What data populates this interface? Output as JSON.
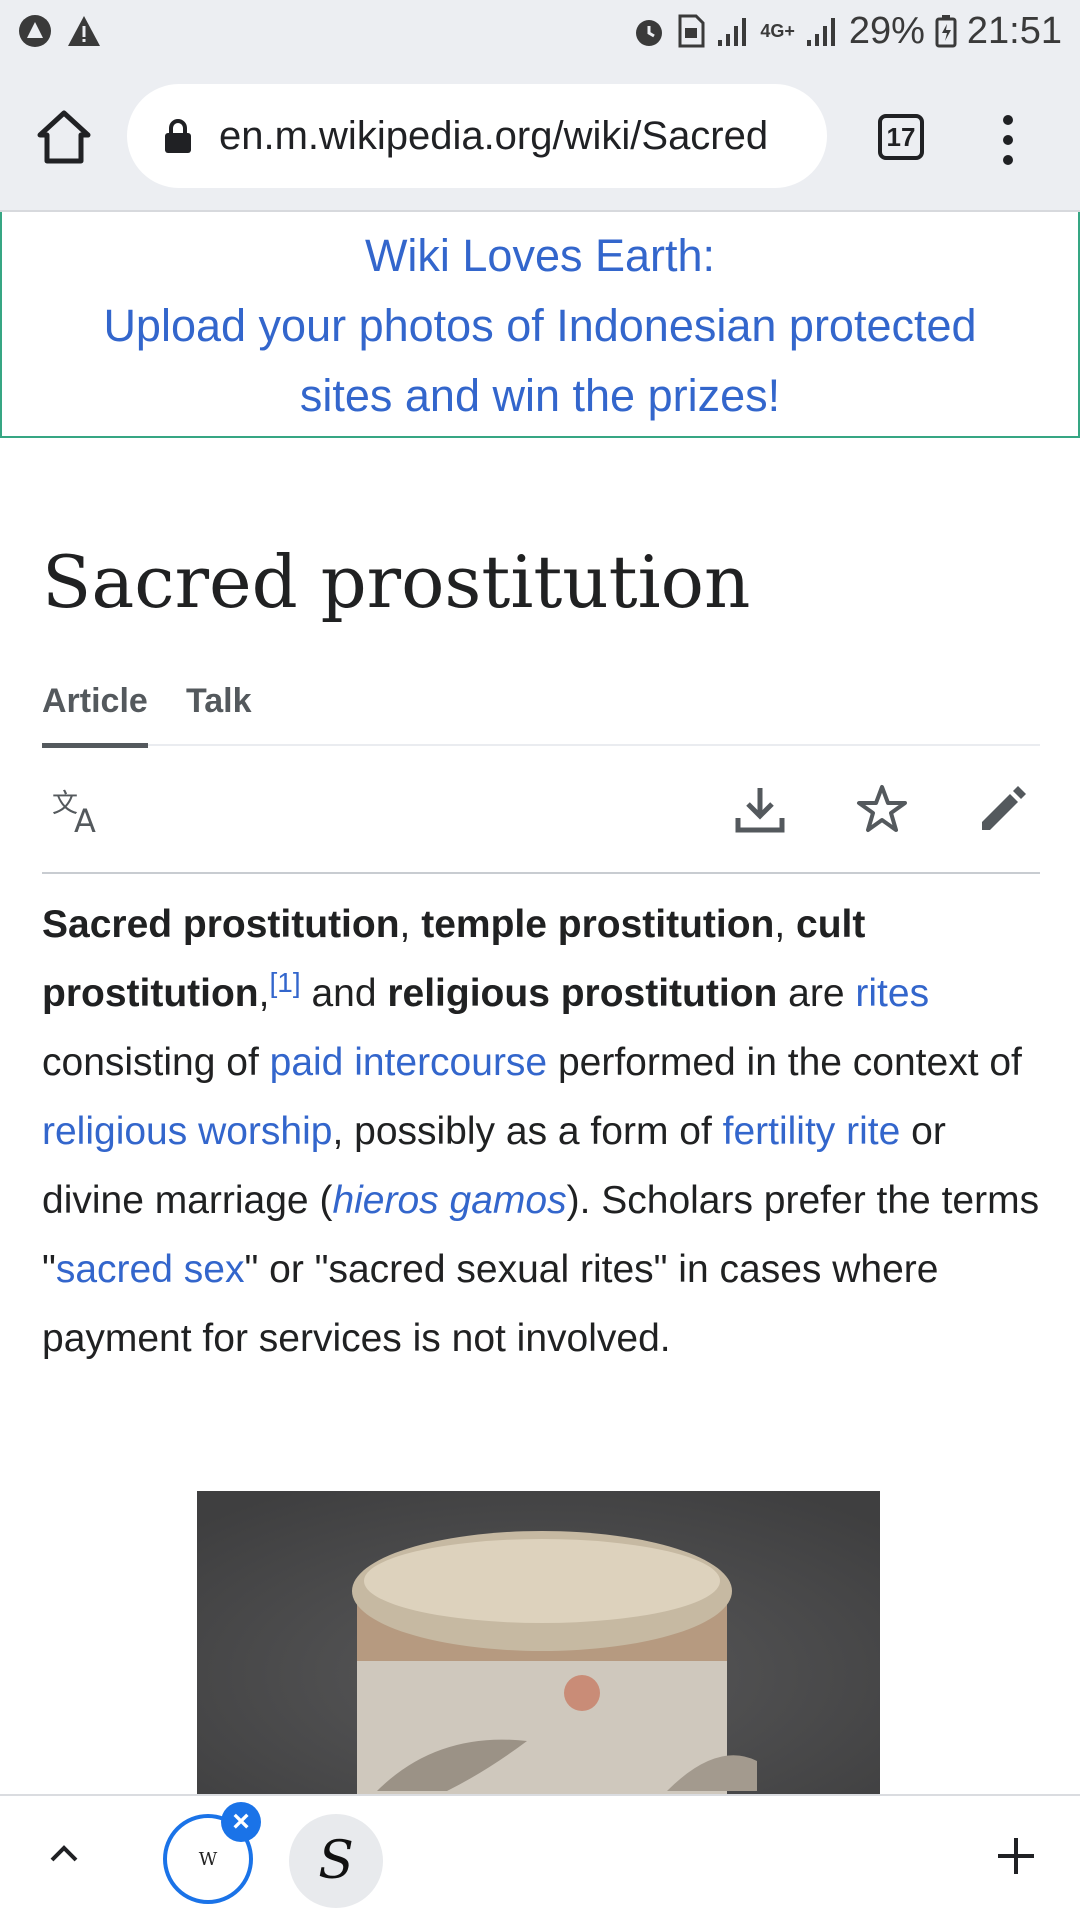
{
  "status": {
    "network": "4G+",
    "battery": "29%",
    "time": "21:51"
  },
  "browser": {
    "url": "en.m.wikipedia.org/wiki/Sacred",
    "tab_count": "17"
  },
  "banner": {
    "line1": "Wiki Loves Earth:",
    "line2": "Upload your photos of Indonesian protected",
    "line3": "sites and win the prizes!"
  },
  "article": {
    "title": "Sacred prostitution",
    "tabs": {
      "article": "Article",
      "talk": "Talk"
    },
    "para": {
      "b1": "Sacred prostitution",
      "t1": ", ",
      "b2": "temple prostitution",
      "t2": ", ",
      "b3": "cult prostitution",
      "t3": ",",
      "ref1": "[1]",
      "t4": " and ",
      "b4": "religious prostitution",
      "t5": " are ",
      "l1": "rites",
      "t6": " consisting of ",
      "l2": "paid intercourse",
      "t7": " performed in the context of ",
      "l3": "religious worship",
      "t8": ", possibly as a form of ",
      "l4": "fertility rite",
      "t9": " or divine marriage (",
      "l5": "hieros gamos",
      "t10": "). Scholars prefer the terms \"",
      "l6": "sacred sex",
      "t11": "\" or \"sacred sexual rites\" in cases where payment for services is not involved."
    }
  },
  "bottom": {
    "tab1_letter": "W",
    "tab2_letter": "S"
  },
  "colors": {
    "link": "#3366cc",
    "accent": "#1a73e8",
    "banner_border": "#36a683"
  }
}
